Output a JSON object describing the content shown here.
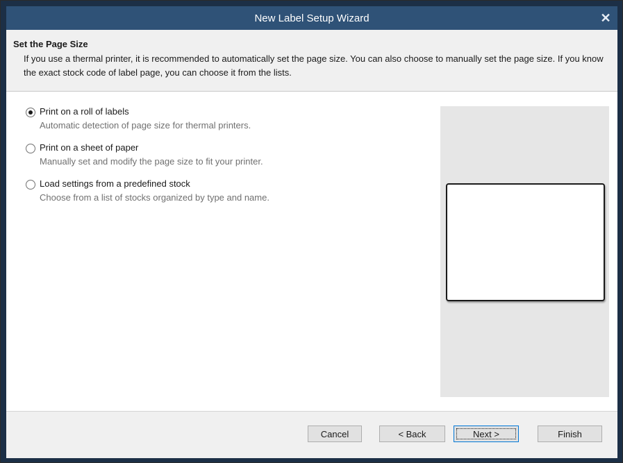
{
  "window": {
    "title": "New Label Setup Wizard",
    "close_glyph": "✕"
  },
  "header": {
    "title": "Set the Page Size",
    "description": "If you use a thermal printer, it is recommended to automatically set the page size. You can also choose to manually set the page size. If you know the exact stock code of label page, you can choose it from the lists."
  },
  "options": [
    {
      "label": "Print on a roll of labels",
      "description": "Automatic detection of page size for thermal printers.",
      "selected": true
    },
    {
      "label": "Print on a sheet of paper",
      "description": "Manually set and modify the page size to fit your printer.",
      "selected": false
    },
    {
      "label": "Load settings from a predefined stock",
      "description": "Choose from a list of stocks organized by type and name.",
      "selected": false
    }
  ],
  "buttons": {
    "cancel": "Cancel",
    "back": "< Back",
    "next": "Next >",
    "finish": "Finish"
  },
  "colors": {
    "titlebar": "#2f5277",
    "preview_bg": "#e6e6e6",
    "default_button_border": "#0078d7"
  }
}
